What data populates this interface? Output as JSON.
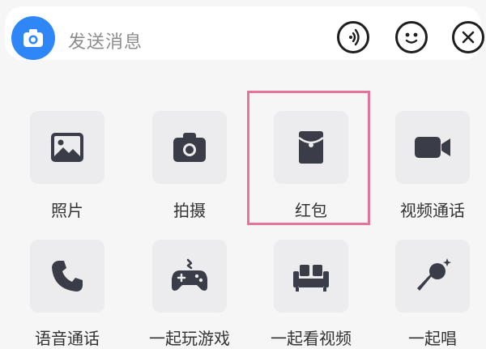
{
  "input_bar": {
    "placeholder": "发送消息",
    "camera_icon": "camera-icon",
    "voice_icon": "voice-icon",
    "emoji_icon": "emoji-icon",
    "close_icon": "close-icon"
  },
  "panel": {
    "items": [
      {
        "label": "照片",
        "icon": "photo-icon"
      },
      {
        "label": "拍摄",
        "icon": "camera-icon"
      },
      {
        "label": "红包",
        "icon": "red-packet-icon",
        "highlighted": true
      },
      {
        "label": "视频通话",
        "icon": "video-call-icon"
      },
      {
        "label": "语音通话",
        "icon": "phone-icon"
      },
      {
        "label": "一起玩游戏",
        "icon": "gamepad-icon"
      },
      {
        "label": "一起看视频",
        "icon": "sofa-icon"
      },
      {
        "label": "一起唱",
        "icon": "microphone-icon"
      }
    ]
  },
  "colors": {
    "accent_blue": "#2f86f6",
    "highlight_pink": "#e5739a",
    "icon_dark": "#3a3d47",
    "tile_bg": "#ececee"
  }
}
